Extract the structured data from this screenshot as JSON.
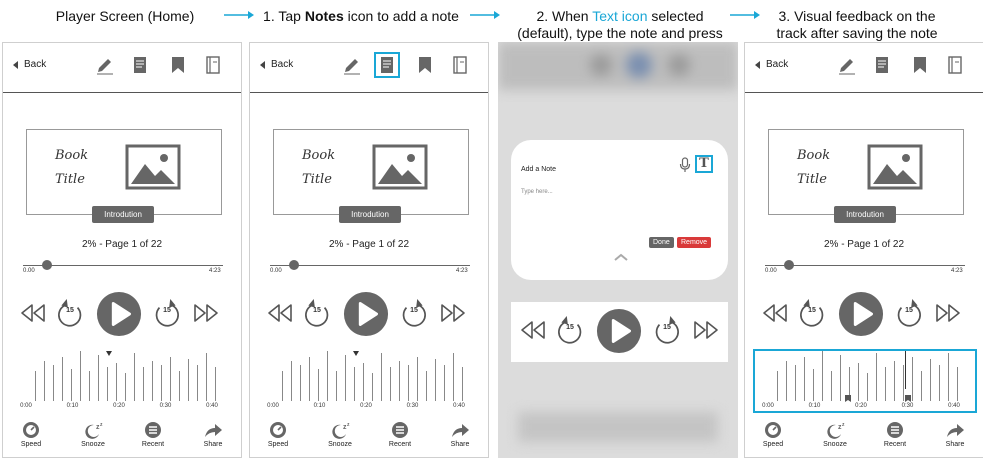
{
  "steps": [
    {
      "text": "Player Screen (Home)"
    },
    {
      "prefix": "1. Tap ",
      "bold": "Notes",
      "suffix": " icon to add a note"
    },
    {
      "line1_prefix": "2. When ",
      "highlight": "Text icon",
      "line1_suffix": " selected",
      "line2": "(default), type the note and press"
    },
    {
      "line1": "3. Visual feedback on the",
      "line2": "track after saving the note"
    }
  ],
  "player": {
    "back_label": "Back",
    "book_title_line1": "Book",
    "book_title_line2": "Title",
    "chapter": "Introdution",
    "progress": "2%  - Page 1 of 22",
    "progress_fraction": 0.12,
    "time_start": "0.00",
    "time_end": "4:23",
    "skip_seconds": "15",
    "timeline_labels": [
      "0:00",
      "0:10",
      "0:20",
      "0:30",
      "0:40"
    ],
    "tabs": [
      {
        "label": "Speed",
        "icon": "speedometer-icon"
      },
      {
        "label": "Snooze",
        "icon": "snooze-icon"
      },
      {
        "label": "Recent",
        "icon": "recent-icon"
      },
      {
        "label": "Share",
        "icon": "share-icon"
      }
    ]
  },
  "modal": {
    "title": "Add a Note",
    "placeholder": "Type here...",
    "done": "Done",
    "remove": "Remove",
    "text_icon_glyph": "T"
  },
  "colors": {
    "accent": "#1aa7d6",
    "remove": "#d93a3a",
    "icon_gray": "#666666"
  }
}
